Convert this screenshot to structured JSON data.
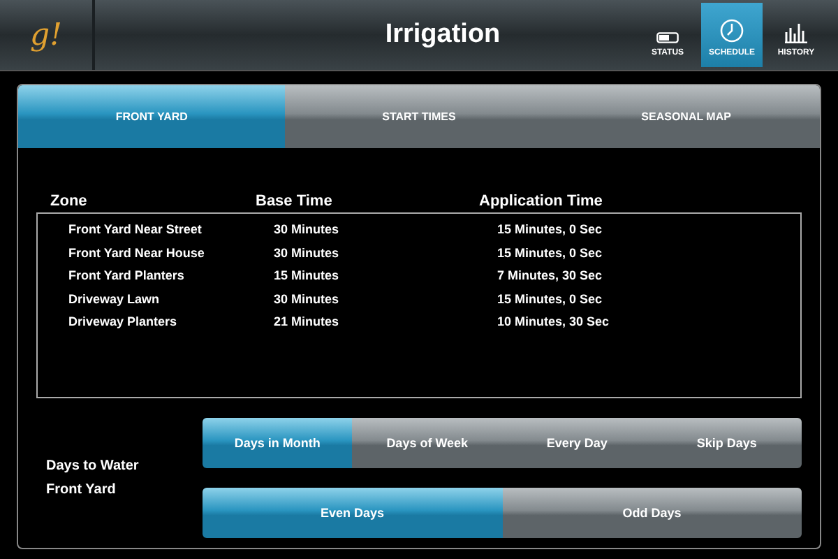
{
  "header": {
    "logo": "g!",
    "title": "Irrigation",
    "nav": [
      {
        "label": "STATUS",
        "selected": false
      },
      {
        "label": "SCHEDULE",
        "selected": true
      },
      {
        "label": "HISTORY",
        "selected": false
      }
    ]
  },
  "tabs": [
    {
      "label": "FRONT YARD",
      "selected": true
    },
    {
      "label": "START TIMES",
      "selected": false
    },
    {
      "label": "SEASONAL MAP",
      "selected": false
    }
  ],
  "table": {
    "columns": [
      "Zone",
      "Base Time",
      "Application Time"
    ],
    "rows": [
      [
        "Front Yard Near Street",
        "30 Minutes",
        "15 Minutes, 0 Sec"
      ],
      [
        "Front Yard Near House",
        "30 Minutes",
        "15 Minutes, 0 Sec"
      ],
      [
        "Front Yard Planters",
        "15 Minutes",
        "7 Minutes, 30 Sec"
      ],
      [
        "Driveway Lawn",
        "30 Minutes",
        "15 Minutes, 0 Sec"
      ],
      [
        "Driveway Planters",
        "21 Minutes",
        "10 Minutes, 30 Sec"
      ]
    ]
  },
  "watering": {
    "label_lines": [
      "Days to Water",
      "Front Yard"
    ],
    "mode": [
      {
        "label": "Days in Month",
        "selected": true
      },
      {
        "label": "Days of Week",
        "selected": false
      },
      {
        "label": "Every Day",
        "selected": false
      },
      {
        "label": "Skip Days",
        "selected": false
      }
    ],
    "parity": [
      {
        "label": "Even Days",
        "selected": true
      },
      {
        "label": "Odd Days",
        "selected": false
      }
    ]
  }
}
